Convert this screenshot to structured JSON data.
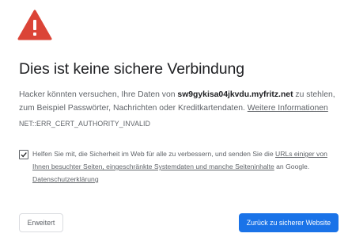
{
  "page": {
    "icon": "warning-triangle-icon",
    "accent_color": "#db4437",
    "button_color": "#1a73e8",
    "title": "Dies ist keine sichere Verbindung",
    "para_pre": "Hacker könnten versuchen, Ihre Daten von ",
    "host": "sw9gykisa04jkvdu.myfritz.net",
    "para_post": " zu stehlen, zum Beispiel Passwörter, Nachrichten oder Kreditkartendaten. ",
    "more_info_link": "Weitere Informationen",
    "error_code": "NET::ERR_CERT_AUTHORITY_INVALID"
  },
  "optin": {
    "checked": true,
    "text_pre": "Helfen Sie mit, die Sicherheit im Web für alle zu verbessern, und senden Sie die ",
    "link_urls": "URLs einiger von Ihnen besuchter Seiten, eingeschränkte Systemdaten und manche Seiteninhalte",
    "text_post": " an Google. ",
    "privacy_link": "Datenschutzerklärung"
  },
  "buttons": {
    "advanced": "Erweitert",
    "back": "Zurück zu sicherer Website"
  }
}
